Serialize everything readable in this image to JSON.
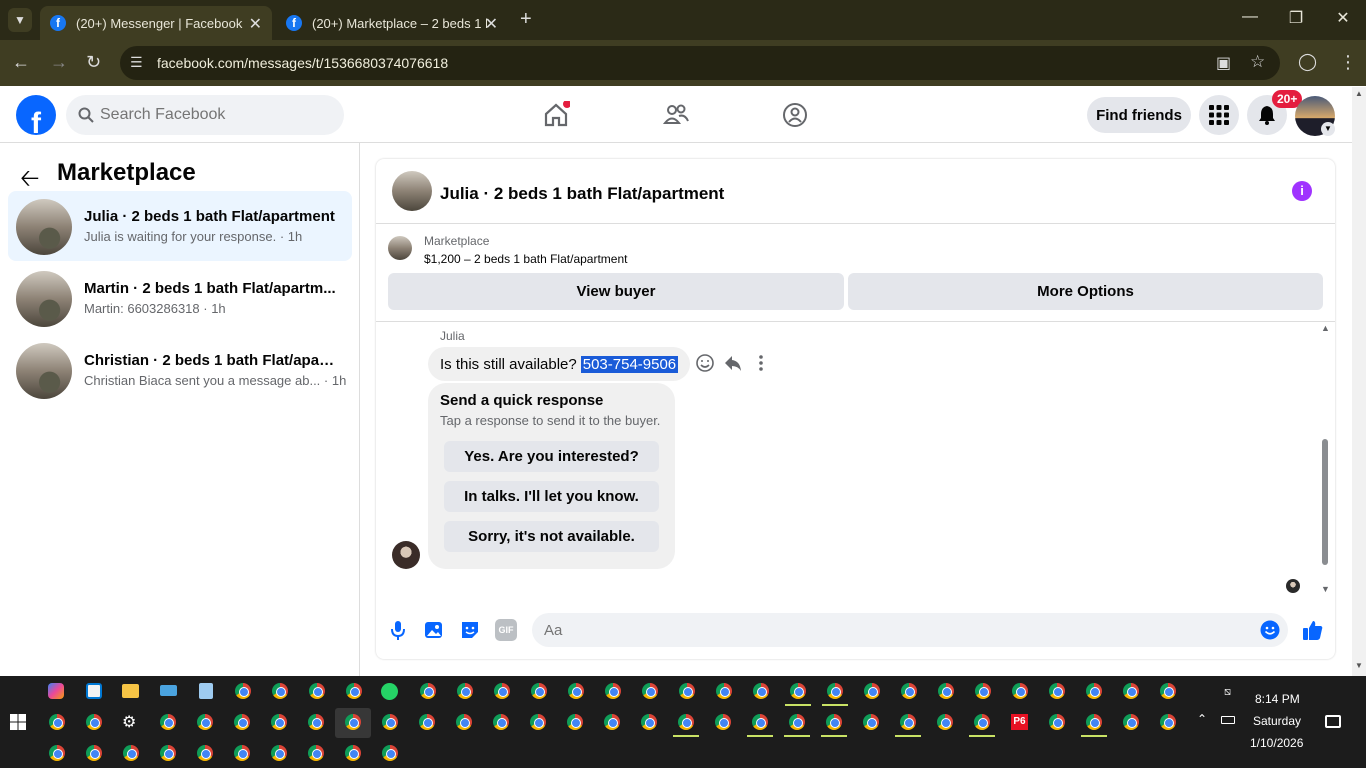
{
  "browser": {
    "tabs": [
      {
        "title": "(20+) Messenger | Facebook"
      },
      {
        "title": "(20+) Marketplace – 2 beds 1 b"
      }
    ],
    "url": "facebook.com/messages/t/1536680374076618"
  },
  "header": {
    "search_placeholder": "Search Facebook",
    "find_friends": "Find friends",
    "notif_badge": "20+"
  },
  "sidebar": {
    "title": "Marketplace",
    "conversations": [
      {
        "title": "Julia · 2 beds 1 bath Flat/apartment",
        "subtitle": "Julia is waiting for your response. · 1h"
      },
      {
        "title": "Martin · 2 beds 1 bath Flat/apartm...",
        "subtitle": "Martin: 6603286318 · 1h"
      },
      {
        "title": "Christian · 2 beds 1 bath Flat/apart...",
        "subtitle": "Christian Biaca sent you a message ab... · 1h"
      }
    ]
  },
  "chat": {
    "title": "Julia · 2 beds 1 bath Flat/apartment",
    "listing_label": "Marketplace",
    "listing_price": "$1,200 – 2 beds 1 bath Flat/apartment",
    "view_buyer": "View buyer",
    "more_options": "More Options",
    "sender": "Julia",
    "message_text": "Is this still available?",
    "message_phone": "503-754-9506",
    "quick_title": "Send a quick response",
    "quick_sub": "Tap a response to send it to the buyer.",
    "quick_responses": [
      "Yes. Are you interested?",
      "In talks. I'll let you know.",
      "Sorry, it's not available."
    ],
    "composer_placeholder": "Aa"
  },
  "taskbar": {
    "time": "8:14 PM",
    "day": "Saturday",
    "date": "1/10/2026",
    "p6_label": "P6"
  }
}
